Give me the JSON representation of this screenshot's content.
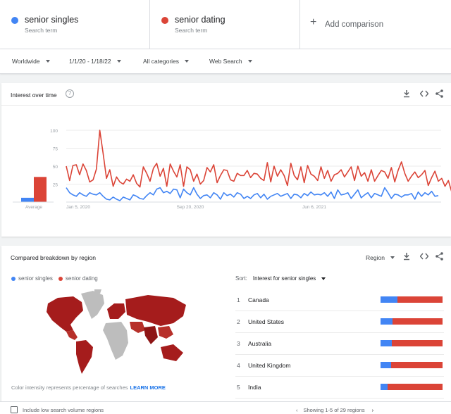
{
  "terms": [
    {
      "name": "senior singles",
      "sub": "Search term",
      "color": "#4285f4"
    },
    {
      "name": "senior dating",
      "sub": "Search term",
      "color": "#db4437"
    }
  ],
  "add_comparison": "Add comparison",
  "filters": {
    "region": "Worldwide",
    "dates": "1/1/20 - 1/18/22",
    "category": "All categories",
    "search_type": "Web Search"
  },
  "interest_card": {
    "title": "Interest over time",
    "help": "?"
  },
  "chart_data": {
    "type": "line",
    "title": "Interest over time",
    "ylim": [
      0,
      100
    ],
    "yticks": [
      25,
      50,
      75,
      100
    ],
    "x_tick_labels": [
      {
        "label": "Jan 5, 2020",
        "index": 0
      },
      {
        "label": "Sep 20, 2020",
        "index": 37
      },
      {
        "label": "Jun 6, 2021",
        "index": 74
      }
    ],
    "average": {
      "label": "Average",
      "values": [
        6,
        35
      ]
    },
    "series": [
      {
        "name": "senior singles",
        "color": "#4285f4",
        "values": [
          20,
          13,
          10,
          8,
          13,
          10,
          8,
          13,
          11,
          10,
          13,
          8,
          4,
          3,
          7,
          4,
          2,
          7,
          5,
          3,
          10,
          8,
          5,
          4,
          9,
          13,
          10,
          18,
          20,
          13,
          15,
          12,
          18,
          17,
          6,
          18,
          13,
          10,
          20,
          11,
          5,
          9,
          10,
          6,
          13,
          10,
          4,
          13,
          9,
          11,
          7,
          13,
          11,
          5,
          8,
          5,
          10,
          12,
          6,
          11,
          4,
          8,
          10,
          12,
          8,
          10,
          12,
          5,
          11,
          10,
          6,
          12,
          9,
          14,
          10,
          11,
          10,
          13,
          8,
          14,
          5,
          17,
          10,
          11,
          13,
          5,
          11,
          17,
          6,
          10,
          13,
          6,
          12,
          10,
          8,
          20,
          13,
          5,
          11,
          10,
          7,
          10,
          10,
          12,
          4,
          14,
          8,
          13,
          10,
          15,
          8,
          9
        ]
      },
      {
        "name": "senior dating",
        "color": "#db4437",
        "values": [
          50,
          30,
          51,
          52,
          38,
          53,
          44,
          28,
          31,
          46,
          100,
          68,
          33,
          45,
          22,
          35,
          28,
          25,
          32,
          29,
          38,
          26,
          21,
          49,
          40,
          29,
          47,
          54,
          36,
          47,
          22,
          53,
          43,
          35,
          52,
          22,
          49,
          45,
          29,
          39,
          25,
          30,
          48,
          42,
          52,
          27,
          37,
          45,
          44,
          31,
          29,
          40,
          37,
          37,
          44,
          34,
          40,
          39,
          33,
          30,
          55,
          28,
          50,
          36,
          45,
          37,
          23,
          54,
          37,
          31,
          49,
          27,
          51,
          39,
          36,
          30,
          49,
          33,
          44,
          29,
          38,
          40,
          45,
          35,
          42,
          49,
          30,
          50,
          36,
          41,
          29,
          45,
          29,
          37,
          44,
          42,
          33,
          48,
          28,
          44,
          56,
          40,
          29,
          36,
          42,
          34,
          38,
          44,
          23,
          34,
          43,
          29,
          33,
          22,
          30,
          14,
          36
        ]
      }
    ]
  },
  "region_card": {
    "title": "Compared breakdown by region",
    "scope_label": "Region",
    "legend": [
      "senior singles",
      "senior dating"
    ],
    "sort_label": "Sort:",
    "sort_value": "Interest for senior singles",
    "rows": [
      {
        "rank": "1",
        "name": "Canada",
        "blue": 27
      },
      {
        "rank": "2",
        "name": "United States",
        "blue": 19
      },
      {
        "rank": "3",
        "name": "Australia",
        "blue": 18
      },
      {
        "rank": "4",
        "name": "United Kingdom",
        "blue": 17
      },
      {
        "rank": "5",
        "name": "India",
        "blue": 11
      }
    ],
    "note": "Color intensity represents percentage of searches",
    "learn_more": "LEARN MORE"
  },
  "bottom": {
    "low_volume": "Include low search volume regions",
    "pagination": "Showing 1-5 of 29 regions"
  }
}
